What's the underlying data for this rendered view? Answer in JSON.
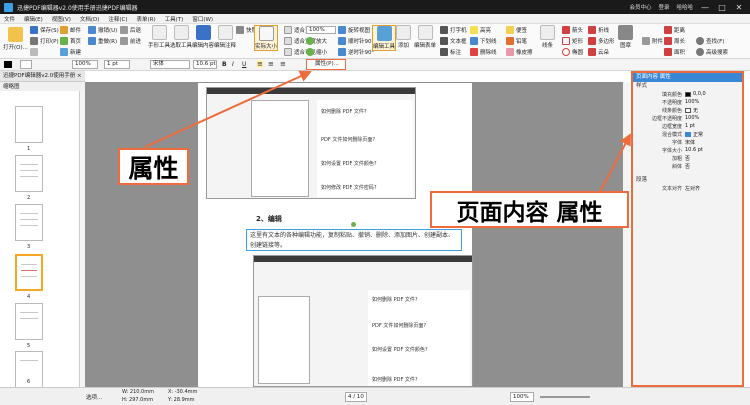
{
  "titlebar": {
    "title": "迅捷PDF编辑器v2.0使用手册迅捷PDF编辑器",
    "member": "会员中心",
    "login": "登录",
    "user": "哈哈哈",
    "minimize": "—",
    "maximize": "□",
    "close": "✕"
  },
  "menu": [
    "文件",
    "编辑(E)",
    "视图(V)",
    "文档(D)",
    "注释(C)",
    "表单(R)",
    "工具(T)",
    "窗口(W)"
  ],
  "ribbon": {
    "open": "打开(O)...",
    "save": "保存(S)",
    "print": "打印(P)",
    "email": "邮件",
    "undo": "撤销(U)",
    "redo": "重做(R)",
    "first_page": "首页",
    "prev": "后退",
    "next": "前进",
    "new": "新建",
    "hand": "手形工具",
    "select_text": "选取工具",
    "edit_content": "编辑内容",
    "annotate": "编辑注释",
    "snapshot": "快照",
    "zoom_actual": "实际大小",
    "fit_page": "适合页面",
    "fit_width": "适合宽度",
    "fit_visible": "适合可见",
    "zoom_in": "放大",
    "zoom_out": "缩小",
    "zoom_value": "100%",
    "rotate_left": "逆时针90°",
    "rotate_right": "顺时针90°",
    "rotate_view": "旋转视图",
    "edit_tool": "编辑工具",
    "add": "添加",
    "edit_form": "编辑表单",
    "typewriter": "打字机",
    "textbox": "文本框",
    "callout_tool": "标注",
    "highlight": "高亮",
    "underline": "下划线",
    "strike": "删除线",
    "note": "便签",
    "pencil": "铅笔",
    "eraser": "橡皮擦",
    "line": "线条",
    "arrow": "箭头",
    "rect": "矩形",
    "ellipse": "椭圆",
    "polyline": "折线",
    "polygon": "多边形",
    "cloud": "云朵",
    "stamp": "图章",
    "attach": "附件",
    "distance": "距离",
    "perimeter": "周长",
    "area": "面积",
    "find": "查找(F)",
    "adv_search": "高级搜索"
  },
  "format": {
    "color1": "#000000",
    "zoom": "100%",
    "line_width": "1 pt",
    "font": "宋体",
    "font_size": "10.6 pt",
    "bold": "B",
    "italic": "I",
    "underline": "U",
    "properties_btn": "属性(P)...",
    "align_left": "≡",
    "align_center": "≡",
    "align_right": "≡"
  },
  "tabs": {
    "doc_tab": "迅捷PDF编辑器v2.0使用手册 ×"
  },
  "thumbs": {
    "header": "缩略图",
    "pages": [
      "1",
      "2",
      "3",
      "4",
      "5",
      "6"
    ],
    "selected_page": "4"
  },
  "page": {
    "section_title": "2、编辑",
    "body_line": "这里有文本的各种编辑功能，复制粘贴、撤销、删除、添加图片、创建副本、创建链接等。",
    "q1": "如何删除 PDF 文件?",
    "q2": "PDF 文件如何删除页面?",
    "q3": "如何设置 PDF 文件颜色?",
    "q4": "如何修改 PDF 文件密码?",
    "q5": "如何删除 PDF 文件?",
    "q6": "PDF 文件如何删除页面?",
    "q7": "如何设置 PDF 文件颜色?",
    "q8": "如何删除 PDF 文件?"
  },
  "props": {
    "header": "页面内容 属性",
    "section_style": "样式",
    "fill_color_label": "填充颜色",
    "fill_color_value": "0,0,0",
    "fill_opacity_label": "不透明度",
    "fill_opacity_value": "100%",
    "border_color_label": "线条颜色",
    "border_color_value": "无",
    "border_opacity_label": "边框不透明度",
    "border_opacity_value": "100%",
    "border_width_label": "边框宽度",
    "border_width_value": "1 pt",
    "blend_label": "混合模式",
    "blend_value": "正常",
    "font_label": "字体",
    "font_value": "宋体",
    "size_label": "字体大小",
    "size_value": "10.6 pt",
    "bold_label": "加粗",
    "bold_value": "否",
    "italic_label": "斜体",
    "italic_value": "否",
    "section_para": "段落",
    "align_label": "文本对齐",
    "align_value": "左对齐"
  },
  "status": {
    "select_label": "选项...",
    "w": "W: 210.0mm",
    "h": "H: 297.0mm",
    "x": "X: -30.4mm",
    "y": "Y: 28.9mm",
    "page_field": "4 / 10",
    "zoom": "100%"
  },
  "callouts": {
    "properties": "属性",
    "page_content_props": "页面内容 属性"
  },
  "colors": {
    "accent": "#ee6c3c",
    "title_bg": "#1a1a1a",
    "header_blue": "#3a87d6"
  }
}
